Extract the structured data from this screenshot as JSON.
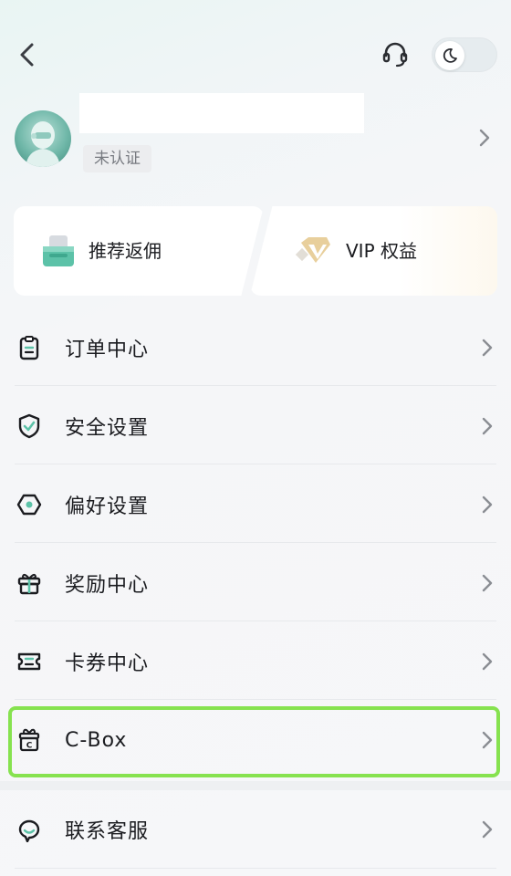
{
  "header": {
    "back_icon": "chevron-left-icon",
    "support_icon": "headset-icon",
    "theme_toggle": {
      "icon": "moon-icon",
      "dark_mode": false
    }
  },
  "profile": {
    "verification_status": "未认证"
  },
  "promos": [
    {
      "label": "推荐返佣",
      "icon": "referral-icon"
    },
    {
      "label": "VIP 权益",
      "icon": "vip-diamond-icon"
    }
  ],
  "menu": [
    {
      "label": "订单中心",
      "icon": "clipboard-icon"
    },
    {
      "label": "安全设置",
      "icon": "shield-icon"
    },
    {
      "label": "偏好设置",
      "icon": "hexagon-settings-icon"
    },
    {
      "label": "奖励中心",
      "icon": "gift-icon"
    },
    {
      "label": "卡券中心",
      "icon": "ticket-icon"
    },
    {
      "label": "C-Box",
      "icon": "cbox-icon",
      "highlighted": true
    },
    {
      "label": "联系客服",
      "icon": "chat-support-icon"
    }
  ],
  "colors": {
    "accent_green": "#5cc2a8",
    "highlight": "#86e24f",
    "vip_gold": "#d9b36a"
  }
}
